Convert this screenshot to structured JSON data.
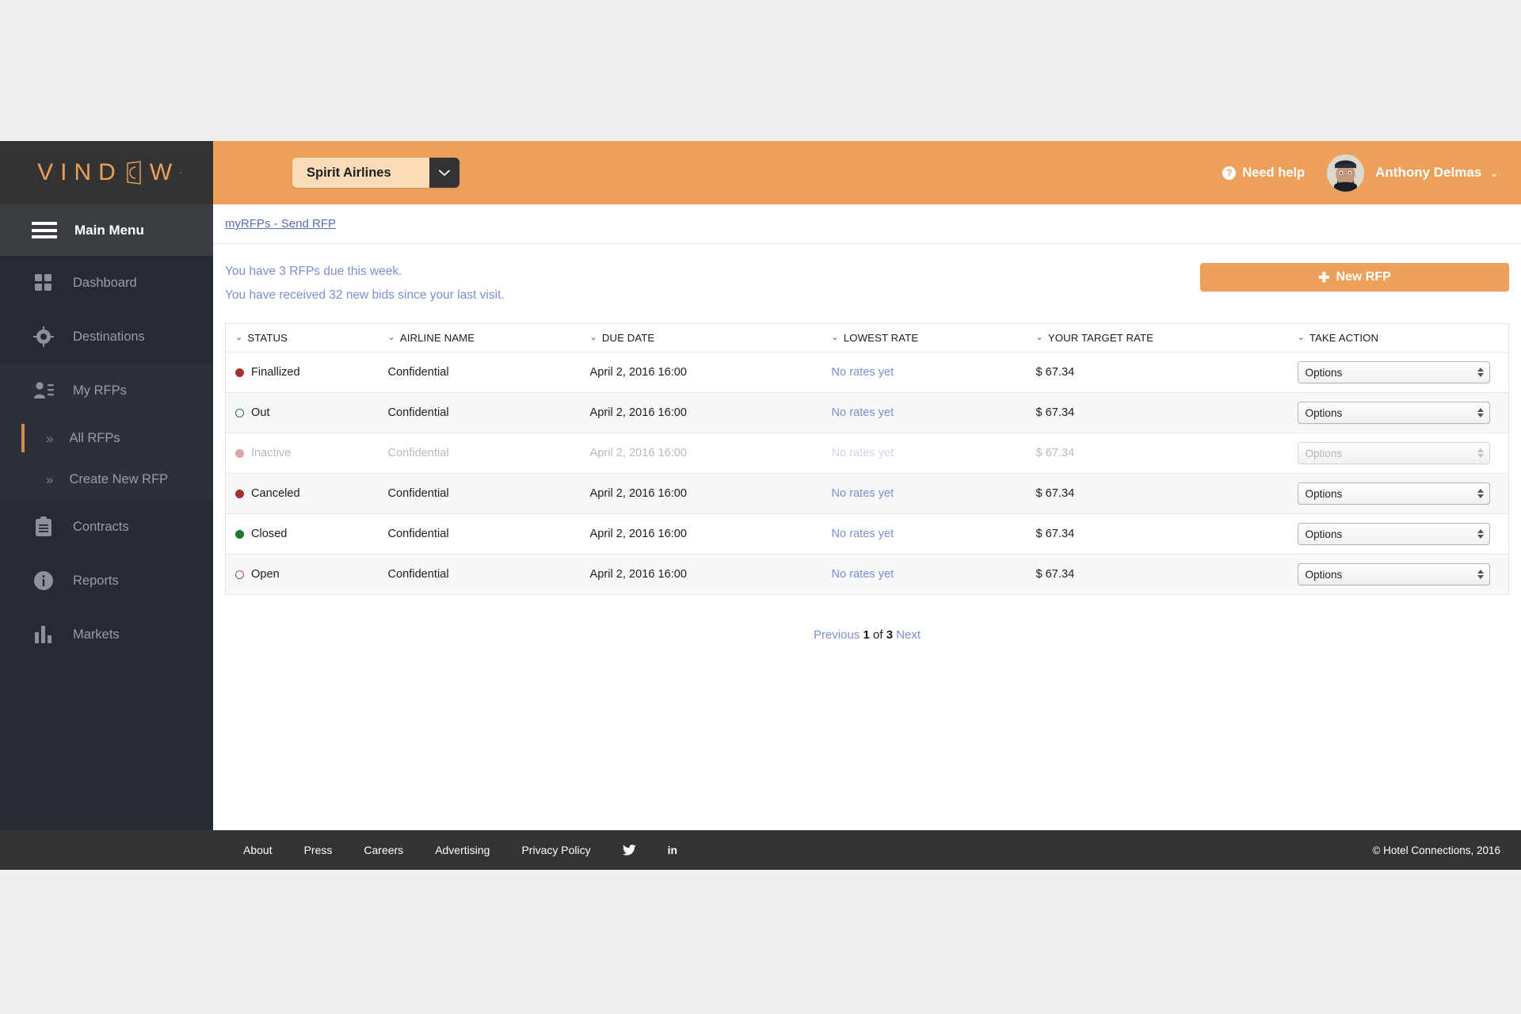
{
  "brand": {
    "logo_text_left": "VIND",
    "logo_text_right": "W",
    "logo_sup": "·",
    "accent_color": "#eda05a"
  },
  "sidebar": {
    "main_menu_label": "Main Menu",
    "items": [
      {
        "label": "Dashboard",
        "icon": "grid-icon"
      },
      {
        "label": "Destinations",
        "icon": "target-icon"
      },
      {
        "label": "My RFPs",
        "icon": "user-list-icon"
      },
      {
        "label": "Contracts",
        "icon": "clipboard-icon"
      },
      {
        "label": "Reports",
        "icon": "info-circle-icon"
      },
      {
        "label": "Markets",
        "icon": "bar-chart-icon"
      }
    ],
    "sub_items": [
      {
        "label": "All RFPs",
        "active": true,
        "chevron": "»"
      },
      {
        "label": "Create New RFP",
        "active": false,
        "chevron": "»"
      }
    ]
  },
  "topbar": {
    "airline_selected": "Spirit Airlines",
    "need_help_label": "Need help",
    "user_name": "Anthony Delmas",
    "user_chevron": "⌄"
  },
  "breadcrumb": {
    "label": "myRFPs - Send RFP"
  },
  "alerts": [
    "You have 3 RFPs due this week.",
    "You have received 32 new bids since your last visit."
  ],
  "actions": {
    "new_rfp_label": "New RFP",
    "new_rfp_plus": "✚"
  },
  "table": {
    "columns": [
      "STATUS",
      "AIRLINE NAME",
      "DUE DATE",
      "LOWEST RATE",
      "YOUR TARGET RATE",
      "TAKE ACTION"
    ],
    "sort_chevron": "⌄",
    "rows": [
      {
        "status": "Finallized",
        "dot": "filled-red",
        "airline": "Confidential",
        "due": "April 2, 2016 16:00",
        "lowest": "No rates yet",
        "target": "$ 67.34",
        "action": "Options",
        "disabled": false
      },
      {
        "status": "Out",
        "dot": "ring-green",
        "airline": "Confidential",
        "due": "April 2, 2016 16:00",
        "lowest": "No rates yet",
        "target": "$ 67.34",
        "action": "Options",
        "disabled": false
      },
      {
        "status": "Inactive",
        "dot": "filled-pink",
        "airline": "Confidential",
        "due": "April 2, 2016 16:00",
        "lowest": "No rates yet",
        "target": "$ 67.34",
        "action": "Options",
        "disabled": true
      },
      {
        "status": "Canceled",
        "dot": "filled-red",
        "airline": "Confidential",
        "due": "April 2, 2016 16:00",
        "lowest": "No rates yet",
        "target": "$ 67.34",
        "action": "Options",
        "disabled": false
      },
      {
        "status": "Closed",
        "dot": "filled-green",
        "airline": "Confidential",
        "due": "April 2, 2016 16:00",
        "lowest": "No rates yet",
        "target": "$ 67.34",
        "action": "Options",
        "disabled": false
      },
      {
        "status": "Open",
        "dot": "ring-red",
        "airline": "Confidential",
        "due": "April 2, 2016 16:00",
        "lowest": "No rates yet",
        "target": "$ 67.34",
        "action": "Options",
        "disabled": false
      }
    ]
  },
  "pagination": {
    "previous": "Previous",
    "current": "1",
    "of": "of",
    "total": "3",
    "next": "Next"
  },
  "footer": {
    "links": [
      "About",
      "Press",
      "Careers",
      "Advertising",
      "Privacy Policy"
    ],
    "social": [
      {
        "name": "twitter-icon",
        "glyph": ""
      },
      {
        "name": "linkedin-icon",
        "glyph": "in"
      }
    ],
    "copyright": "© Hotel Connections, 2016"
  }
}
